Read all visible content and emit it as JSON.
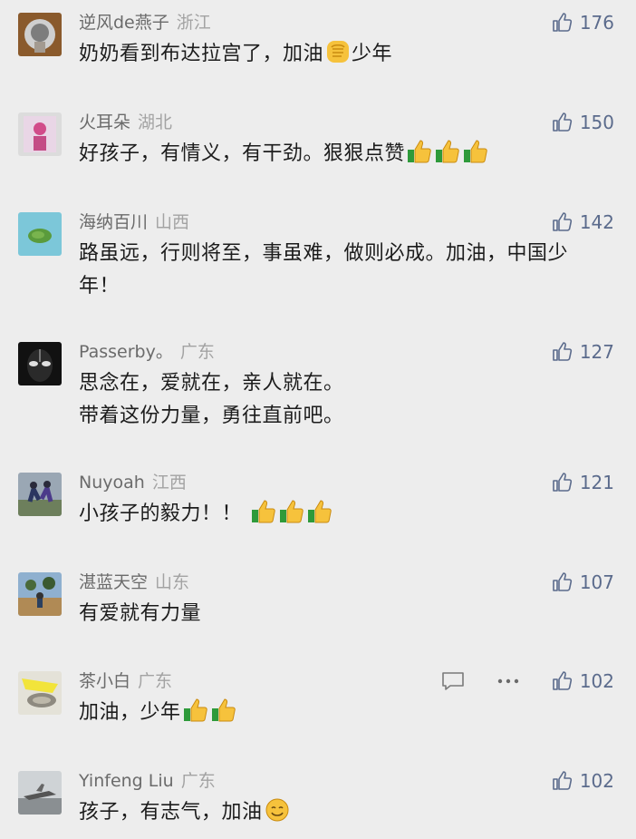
{
  "comments": [
    {
      "nickname": "逆风de燕子",
      "region": "浙江",
      "likes": "176",
      "lines": [
        "奶奶看到布达拉宫了，加油"
      ],
      "emoji": "fist",
      "after": "少年"
    },
    {
      "nickname": "火耳朵",
      "region": "湖北",
      "likes": "150",
      "lines": [
        "好孩子，有情义，有干劲。狠狠点赞"
      ],
      "emoji_count": 3
    },
    {
      "nickname": "海纳百川",
      "region": "山西",
      "likes": "142",
      "lines": [
        "路虽远，行则将至，事虽难，做则必成。加油，中国少",
        "年！"
      ]
    },
    {
      "nickname": "Passerby。",
      "region": "广东",
      "likes": "127",
      "lines": [
        "思念在，爱就在，亲人就在。",
        "带着这份力量，勇往直前吧。"
      ]
    },
    {
      "nickname": "Nuyoah",
      "region": "江西",
      "likes": "121",
      "lines": [
        "小孩子的毅力！！"
      ],
      "emoji_count": 3
    },
    {
      "nickname": "湛蓝天空",
      "region": "山东",
      "likes": "107",
      "lines": [
        "有爱就有力量"
      ]
    },
    {
      "nickname": "茶小白",
      "region": "广东",
      "likes": "102",
      "lines": [
        "加油，少年"
      ],
      "emoji_count": 2
    },
    {
      "nickname": "Yinfeng Liu",
      "region": "广东",
      "likes": "102",
      "lines": [
        "孩子，有志气，加油"
      ],
      "emoji": "smile"
    }
  ],
  "icons": {
    "like": "thumbs-up-icon",
    "reply": "reply-bubble-icon",
    "more": "more-dots-icon",
    "thumbs": "thumbs-up-emoji",
    "fist": "fist-emoji",
    "smile": "smile-emoji"
  },
  "colors": {
    "background": "#ededed",
    "nickname": "#6b6b6b",
    "region": "#a3a3a3",
    "like": "#5b6b8c",
    "text": "#1c1c1c"
  }
}
